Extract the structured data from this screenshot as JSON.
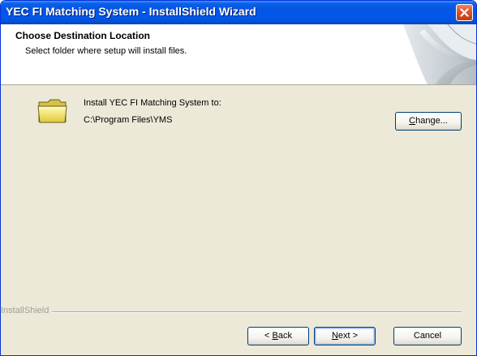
{
  "window": {
    "title": "YEC FI Matching System - InstallShield Wizard"
  },
  "header": {
    "title": "Choose Destination Location",
    "subtitle": "Select folder where setup will install files."
  },
  "destination": {
    "label": "Install YEC FI Matching System to:",
    "path": "C:\\Program Files\\YMS",
    "change_button": {
      "mnemonic": "C",
      "rest": "hange..."
    }
  },
  "footer": {
    "brand": "InstallShield",
    "back_button": {
      "prefix": "< ",
      "mnemonic": "B",
      "rest": "ack"
    },
    "next_button": {
      "mnemonic": "N",
      "rest": "ext >"
    },
    "cancel_button": "Cancel"
  },
  "colors": {
    "titlebar": "#0554e3",
    "dialog_face": "#ece9d8",
    "button_border": "#003c74",
    "close_button": "#d8552e"
  },
  "icons": {
    "close": "close-icon",
    "folder": "folder-icon",
    "header_art": "page-curl-art"
  }
}
